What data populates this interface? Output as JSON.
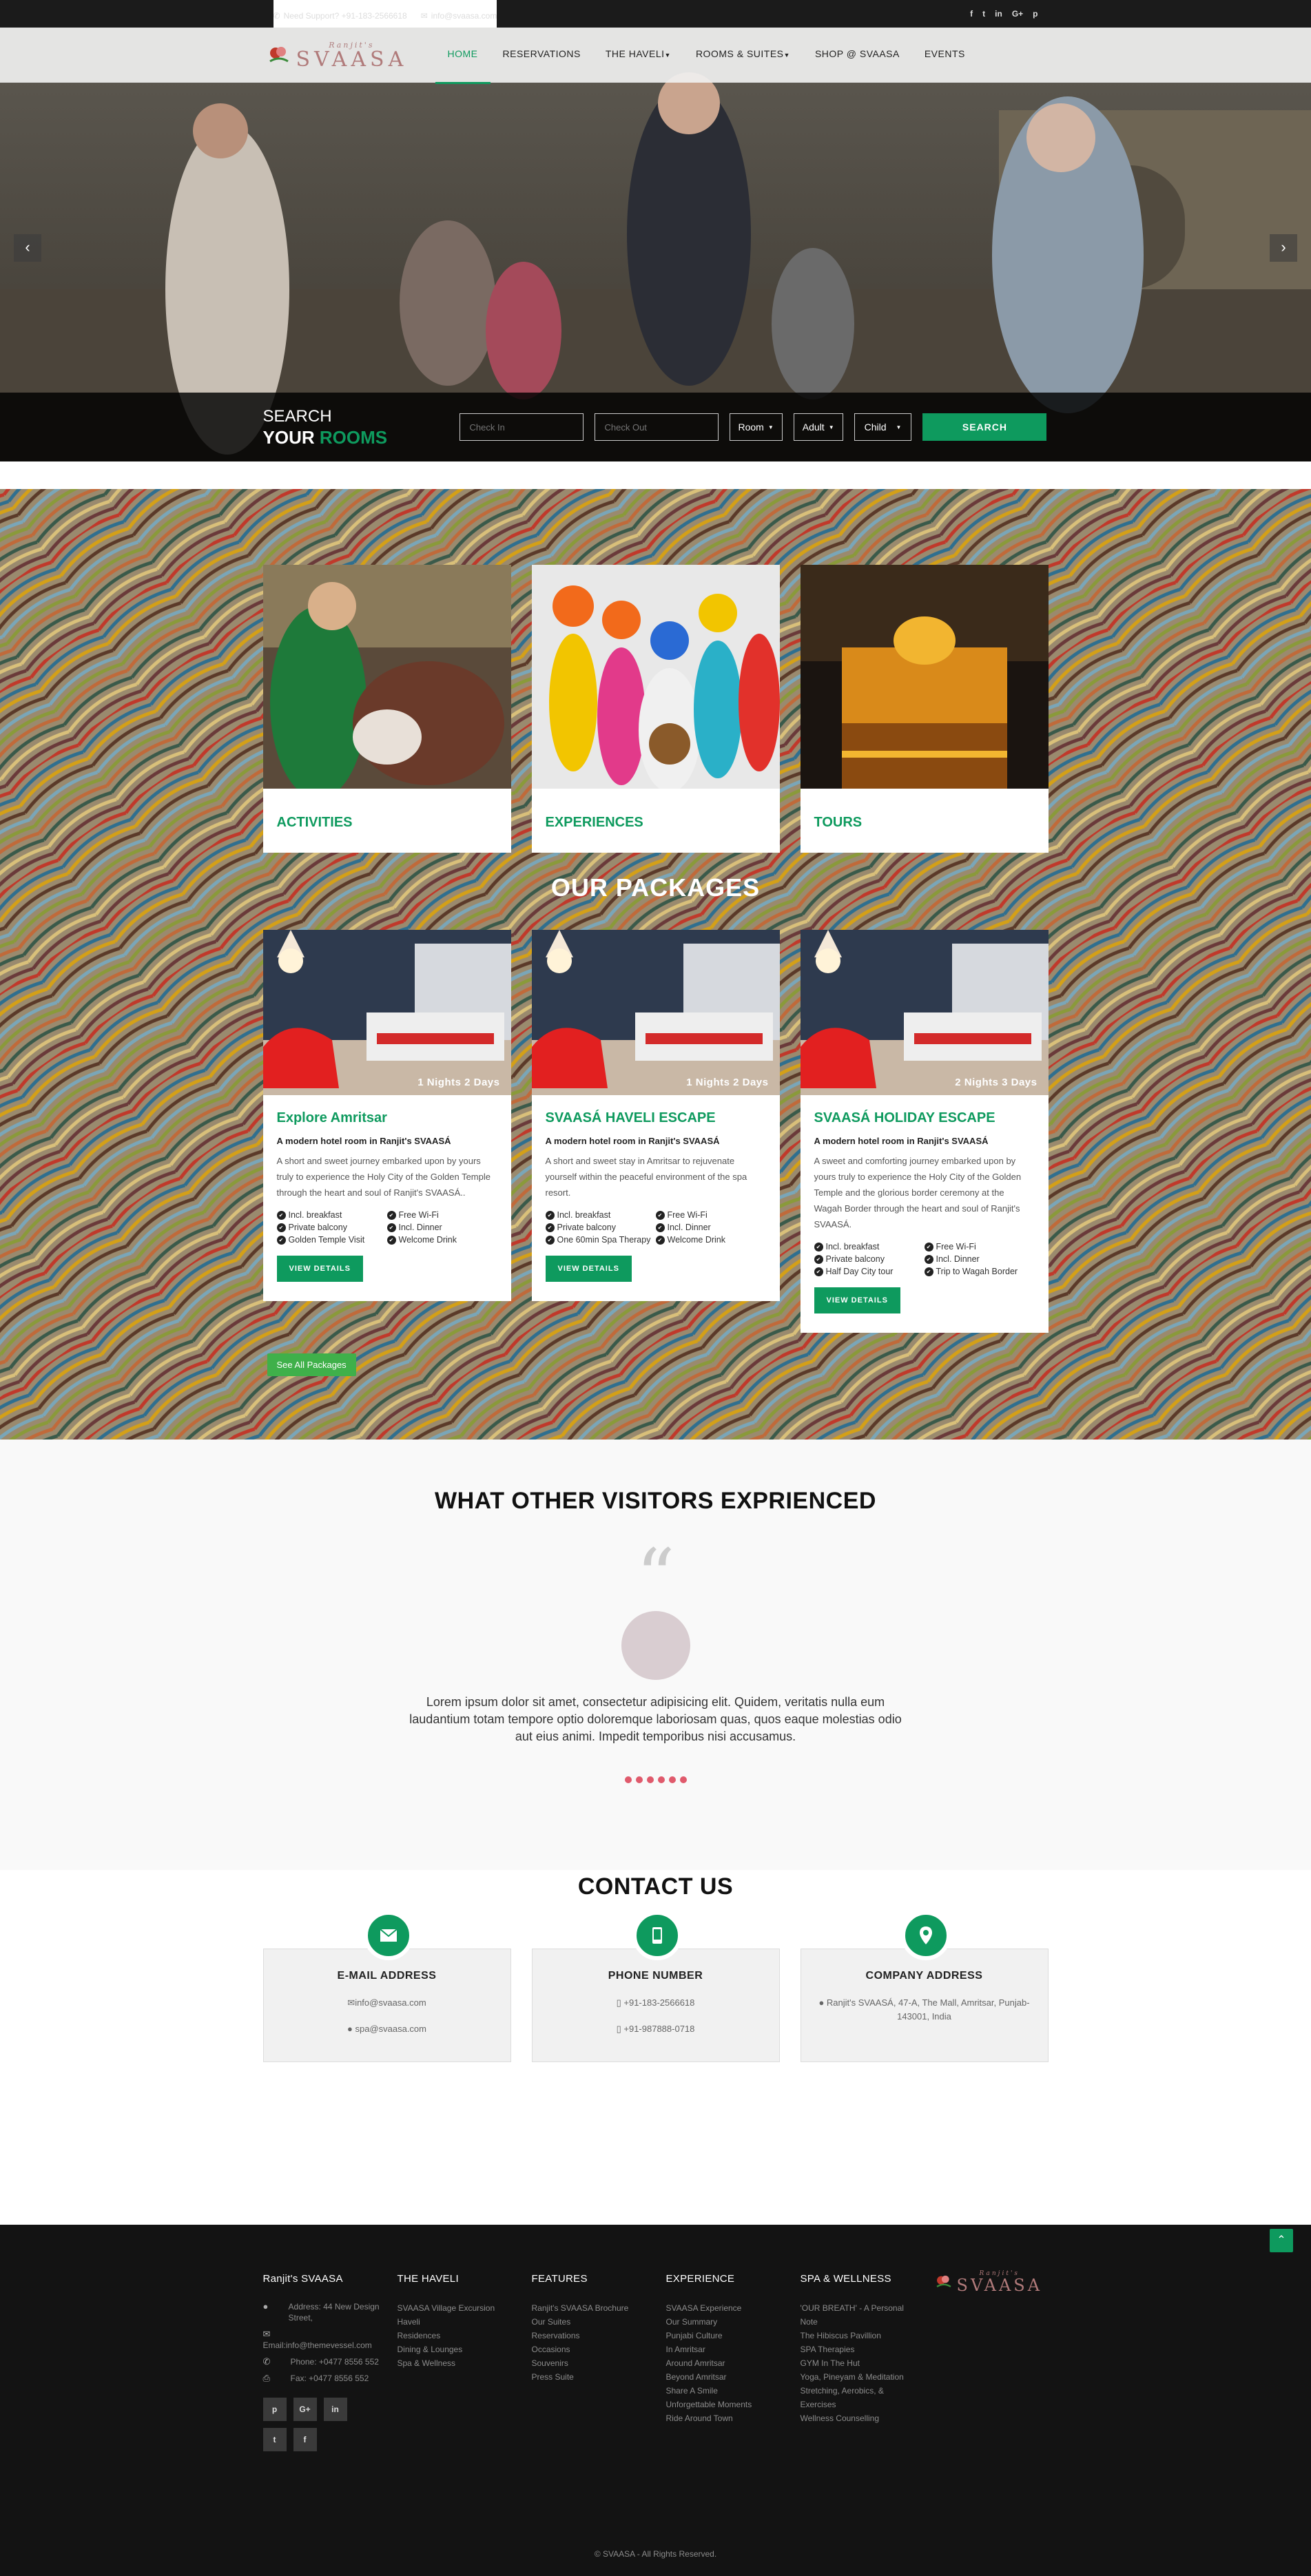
{
  "topbar": {
    "support": "Need Support? +91-183-2566618",
    "email": "info@svaasa.com",
    "social": [
      "f",
      "t",
      "in",
      "G+",
      "p"
    ]
  },
  "nav": {
    "logo_small": "Ranjit's",
    "logo_big": "SVAASA",
    "items": [
      "HOME",
      "RESERVATIONS",
      "THE HAVELI",
      "ROOMS & SUITES",
      "SHOP @ SVAASA",
      "EVENTS"
    ]
  },
  "search": {
    "title1": "SEARCH",
    "title2a": "YOUR",
    "title2b": "ROOMS",
    "checkin_placeholder": "Check In",
    "checkout_placeholder": "Check Out",
    "room": "Room",
    "adult": "Adult",
    "child": "Child",
    "button": "SEARCH"
  },
  "activities": [
    "ACTIVITIES",
    "EXPERIENCES",
    "TOURS"
  ],
  "packages": {
    "title": "OUR PACKAGES",
    "items": [
      {
        "nights": "1 Nights 2 Days",
        "title": "Explore Amritsar",
        "subtitle": "A modern hotel room in Ranjit's SVAASÁ",
        "desc": "A short and sweet journey embarked upon by yours truly to experience the Holy City of the Golden Temple through the heart and soul of Ranjit's SVAASÁ..",
        "features": [
          "Incl. breakfast",
          "Free Wi-Fi",
          "Private balcony",
          "Incl. Dinner",
          "Golden Temple Visit",
          "Welcome Drink"
        ],
        "button": "VIEW DETAILS"
      },
      {
        "nights": "1 Nights 2 Days",
        "title": "SVAASÁ HAVELI ESCAPE",
        "subtitle": "A modern hotel room in Ranjit's SVAASÁ",
        "desc": "A short and sweet stay in Amritsar to rejuvenate yourself within the peaceful environment of the spa resort.",
        "features": [
          "Incl. breakfast",
          "Free Wi-Fi",
          "Private balcony",
          "Incl. Dinner",
          "One 60min Spa Therapy",
          "Welcome Drink"
        ],
        "button": "VIEW DETAILS"
      },
      {
        "nights": "2 Nights 3 Days",
        "title": "SVAASÁ HOLIDAY ESCAPE",
        "subtitle": "A modern hotel room in Ranjit's SVAASÁ",
        "desc": "A sweet and comforting journey embarked upon by yours truly to experience the Holy City of the Golden Temple and the glorious border ceremony at the Wagah Border through the heart and soul of Ranjit's SVAASÁ.",
        "features": [
          "Incl. breakfast",
          "Free Wi-Fi",
          "Private balcony",
          "Incl. Dinner",
          "Half Day City tour",
          "Trip to Wagah Border"
        ],
        "button": "VIEW DETAILS"
      }
    ],
    "see_all": "See All Packages"
  },
  "testimonials": {
    "title": "WHAT OTHER VISITORS EXPRIENCED",
    "text": "Lorem ipsum dolor sit amet, consectetur adipisicing elit. Quidem, veritatis nulla eum laudantium totam tempore optio doloremque laboriosam quas, quos eaque molestias odio aut eius animi. Impedit temporibus nisi accusamus."
  },
  "contact": {
    "title": "CONTACT US",
    "email": {
      "title": "E-MAIL ADDRESS",
      "line1": "info@svaasa.com",
      "line2": "spa@svaasa.com"
    },
    "phone": {
      "title": "PHONE NUMBER",
      "line1": "+91-183-2566618",
      "line2": "+91-987888-0718"
    },
    "address": {
      "title": "COMPANY ADDRESS",
      "line1": "Ranjit's SVAASÁ, 47-A, The Mall, Amritsar, Punjab-143001, India"
    }
  },
  "footer": {
    "col1": {
      "title": "Ranjit's SVAASA",
      "address": "Address: 44 New Design Street,",
      "email": "Email:info@themevessel.com",
      "phone": "Phone: +0477 8556 552",
      "fax": "Fax: +0477 8556 552",
      "social": [
        "p",
        "G+",
        "in",
        "t",
        "f"
      ]
    },
    "col2": {
      "title": "THE HAVELI",
      "links": [
        "SVAASA Village Excursion Haveli",
        "Residences",
        "Dining & Lounges",
        "Spa & Wellness"
      ]
    },
    "col3": {
      "title": "FEATURES",
      "links": [
        "Ranjit's SVAASA Brochure",
        "Our Suites",
        "Reservations",
        "Occasions",
        "Souvenirs",
        "Press Suite"
      ]
    },
    "col4": {
      "title": "EXPERIENCE",
      "links": [
        "SVAASA Experience",
        "Our Summary",
        "Punjabi Culture",
        "In Amritsar",
        "Around Amritsar",
        "Beyond Amritsar",
        "Share A Smile",
        "Unforgettable Moments",
        "Ride Around Town"
      ]
    },
    "col5": {
      "title": "SPA & WELLNESS",
      "links": [
        "'OUR BREATH' - A Personal Note",
        "The Hibiscus Pavillion",
        "SPA Therapies",
        "GYM In The Hut",
        "Yoga, Pineyam & Meditation",
        "Stretching, Aerobics, & Exercises",
        "Wellness Counselling"
      ]
    },
    "copyright": "© SVAASA - All Rights Reserved."
  }
}
